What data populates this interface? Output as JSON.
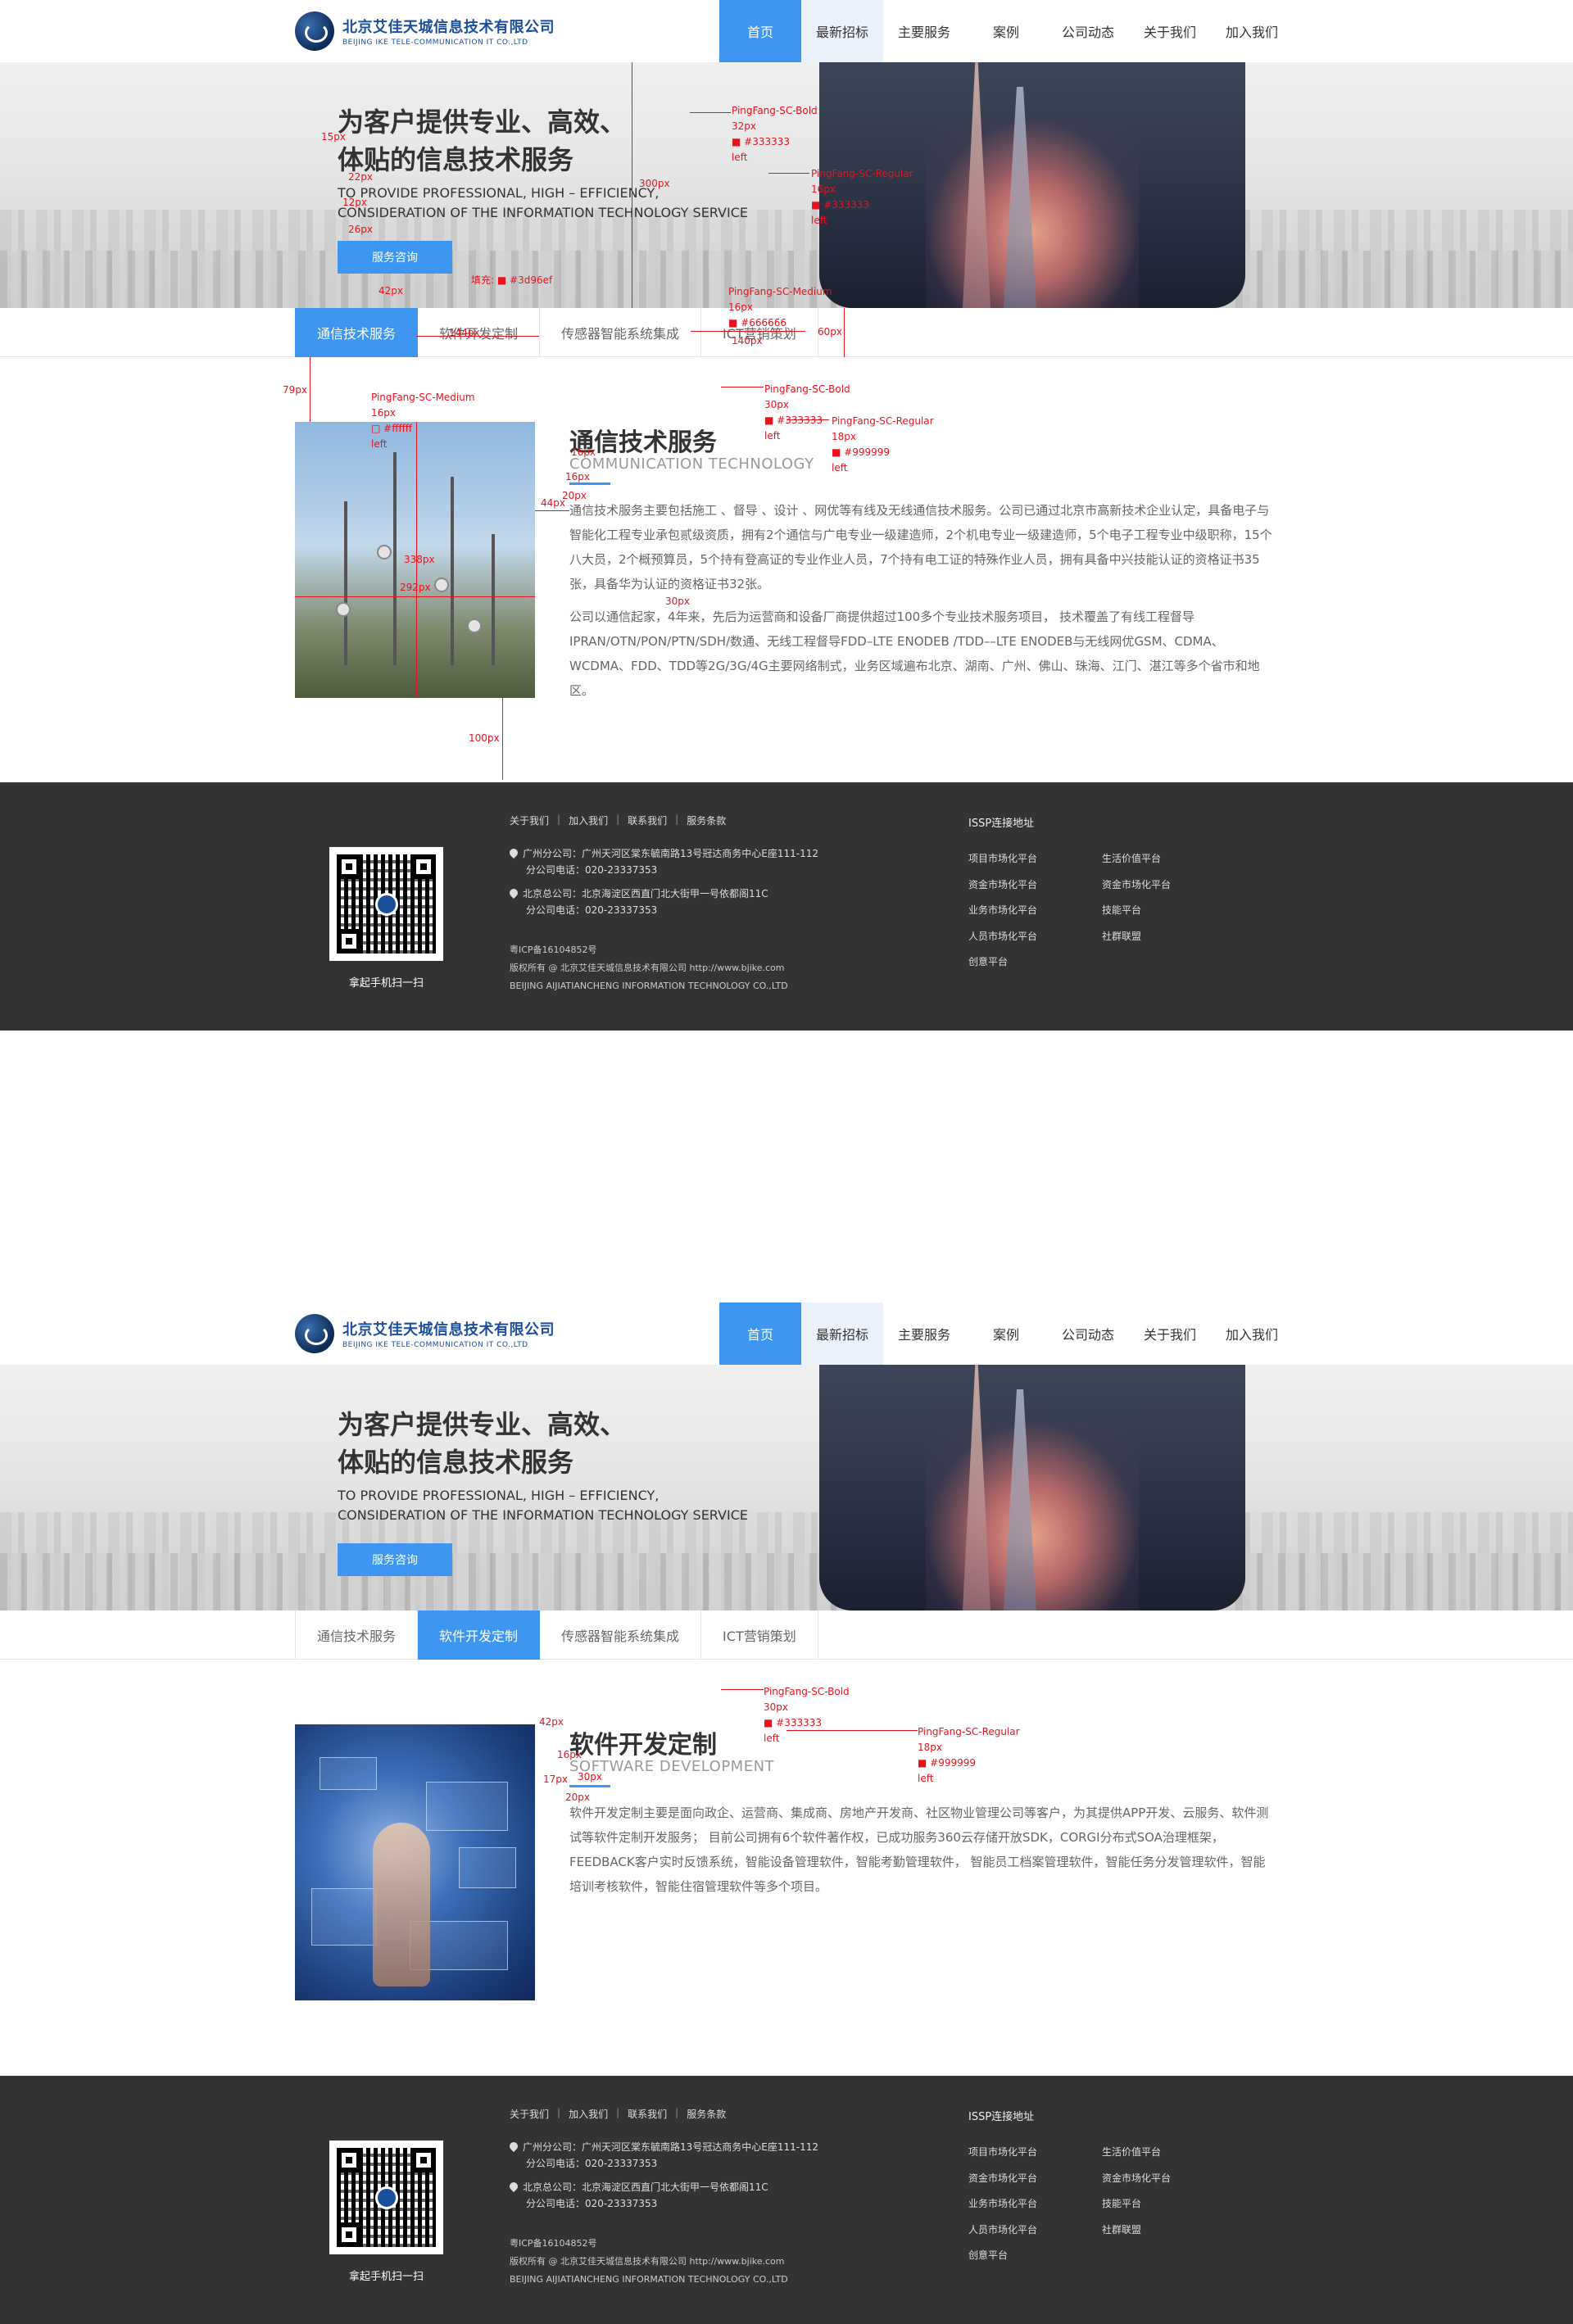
{
  "header": {
    "logo_cn": "北京艾佳天城信息技术有限公司",
    "logo_en": "BEIJING IKE TELE-COMMUNICATION IT CO.,LTD",
    "nav": [
      "首页",
      "最新招标",
      "主要服务",
      "案例",
      "公司动态",
      "关于我们",
      "加入我们"
    ]
  },
  "banner": {
    "title_line1": "为客户提供专业、高效、",
    "title_line2": "体贴的信息技术服务",
    "sub_line1": "TO PROVIDE PROFESSIONAL, HIGH – EFFICIENCY,",
    "sub_line2": "CONSIDERATION OF THE INFORMATION TECHNOLOGY SERVICE",
    "button": "服务咨询"
  },
  "tabs": [
    "通信技术服务",
    "软件开发定制",
    "传感器智能系统集成",
    "ICT营销策划"
  ],
  "section1": {
    "title": "通信技术服务",
    "title_en": "COMMUNICATION TECHNOLOGY",
    "p1": "通信技术服务主要包括施工 、督导 、设计 、网优等有线及无线通信技术服务。公司已通过北京市高新技术企业认定，具备电子与智能化工程专业承包贰级资质，拥有2个通信与广电专业一级建造师，2个机电专业一级建造师，5个电子工程专业中级职称，15个八大员，2个概预算员，5个持有登高证的专业作业人员，7个持有电工证的特殊作业人员，拥有具备中兴技能认证的资格证书35张，具备华为认证的资格证书32张。",
    "p2": "公司以通信起家，4年来，先后为运营商和设备厂商提供超过100多个专业技术服务项目，  技术覆盖了有线工程督导IPRAN/OTN/PON/PTN/SDH/数通、无线工程督导FDD–LTE ENODEB /TDD––LTE ENODEB与无线网优GSM、CDMA、WCDMA、FDD、TDD等2G/3G/4G主要网络制式，业务区域遍布北京、湖南、广州、佛山、珠海、江门、湛江等多个省市和地区。"
  },
  "section2": {
    "title": "软件开发定制",
    "title_en": "SOFTWARE DEVELOPMENT",
    "p1": "软件开发定制主要是面向政企、运营商、集成商、房地产开发商、社区物业管理公司等客户，为其提供APP开发、云服务、软件测试等软件定制开发服务；  目前公司拥有6个软件著作权，已成功服务360云存储开放SDK，CORGI分布式SOA治理框架，FEEDBACK客户实时反馈系统，智能设备管理软件，智能考勤管理软件， 智能员工档案管理软件，智能任务分发管理软件，智能培训考核软件，智能住宿管理软件等多个项目。"
  },
  "footer": {
    "links": [
      "关于我们",
      "加入我们",
      "联系我们",
      "服务条款"
    ],
    "addr1_line1": "广州分公司：广州天河区棠东毓南路13号冠达商务中心E座111-112",
    "addr1_line2": "分公司电话：020-23337353",
    "addr2_line1": "北京总公司：北京海淀区西直门北大街甲一号依都阁11C",
    "addr2_line2": "分公司电话：020-23337353",
    "icp": "粤ICP备16104852号",
    "copyright": "版权所有 @ 北京艾佳天城信息技术有限公司 http://www.bjike.com",
    "company_en": "BEIJING AIJIATIANCHENG INFORMATION TECHNOLOGY CO.,LTD",
    "qr_caption": "拿起手机扫一扫",
    "issp_title": "ISSP连接地址",
    "issp_col1": [
      "项目市场化平台",
      "资金市场化平台",
      "业务市场化平台",
      "人员市场化平台",
      "创意平台"
    ],
    "issp_col2": [
      "生活价值平台",
      "资金市场化平台",
      "技能平台",
      "社群联盟"
    ]
  },
  "annotations": {
    "a_banner_title": [
      "PingFang-SC-Bold",
      "32px",
      "■ #333333",
      "left"
    ],
    "a_banner_sub": [
      "PingFang-SC-Regular",
      "16px",
      "■ #333333",
      "left"
    ],
    "a_tab": [
      "PingFang-SC-Medium",
      "16px",
      "■ #666666",
      "left"
    ],
    "a_tab_active": [
      "PingFang-SC-Medium",
      "16px",
      "□ #ffffff",
      "left"
    ],
    "a_title": [
      "PingFang-SC-Bold",
      "30px",
      "■ #333333",
      "left"
    ],
    "a_title_en": [
      "PingFang-SC-Regular",
      "18px",
      "■ #999999",
      "left"
    ],
    "a_btn_fill": "填充: ■ #3d96ef",
    "px_15": "15px",
    "px_22": "22px",
    "px_12": "12px",
    "px_26": "26px",
    "px_42": "42px",
    "px_300": "300px",
    "px_144": "144px",
    "px_140": "140px",
    "px_60": "60px",
    "px_79": "79px",
    "px_16": "16px",
    "px_20": "20px",
    "px_44": "44px",
    "px_338": "338px",
    "px_292": "292px",
    "px_30": "30px",
    "px_100": "100px",
    "px_17": "17px"
  }
}
